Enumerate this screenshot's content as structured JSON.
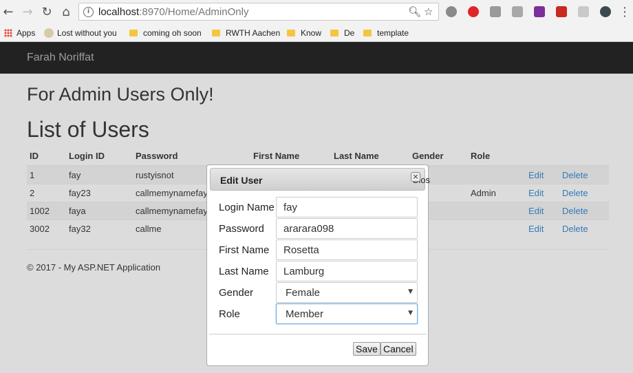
{
  "browser": {
    "url_host": "localhost",
    "url_path": ":8970/Home/AdminOnly",
    "bookmarks": [
      "Apps",
      "Lost without you",
      "coming oh soon",
      "RWTH Aachen",
      "Know",
      "De",
      "template"
    ]
  },
  "navbar": {
    "brand": "Farah Noriffat"
  },
  "page": {
    "subtitle": "For Admin Users Only!",
    "title": "List of Users",
    "table": {
      "headers": [
        "ID",
        "Login ID",
        "Password",
        "First Name",
        "Last Name",
        "Gender",
        "Role"
      ],
      "rows": [
        {
          "id": "1",
          "login": "fay",
          "password": "rustyisnot",
          "role": "",
          "edit": "Edit",
          "delete": "Delete"
        },
        {
          "id": "2",
          "login": "fay23",
          "password": "callmemynamefay",
          "role": "Admin",
          "edit": "Edit",
          "delete": "Delete"
        },
        {
          "id": "1002",
          "login": "faya",
          "password": "callmemynamefay",
          "role": "",
          "edit": "Edit",
          "delete": "Delete"
        },
        {
          "id": "3002",
          "login": "fay32",
          "password": "callme",
          "role": "",
          "edit": "Edit",
          "delete": "Delete"
        }
      ]
    },
    "footer": "© 2017 - My ASP.NET Application"
  },
  "dialog": {
    "title": "Edit User",
    "close_label": "Clos",
    "labels": {
      "login": "Login Name",
      "password": "Password",
      "first": "First Name",
      "last": "Last Name",
      "gender": "Gender",
      "role": "Role"
    },
    "values": {
      "login": "fay",
      "password": "ararara098",
      "first": "Rosetta",
      "last": "Lamburg",
      "gender": "Female",
      "role": "Member"
    },
    "save": "Save",
    "cancel": "Cancel"
  },
  "colors": {
    "navbar": "#222222",
    "link": "#337ab7",
    "page_bg": "#dcdcdc"
  }
}
